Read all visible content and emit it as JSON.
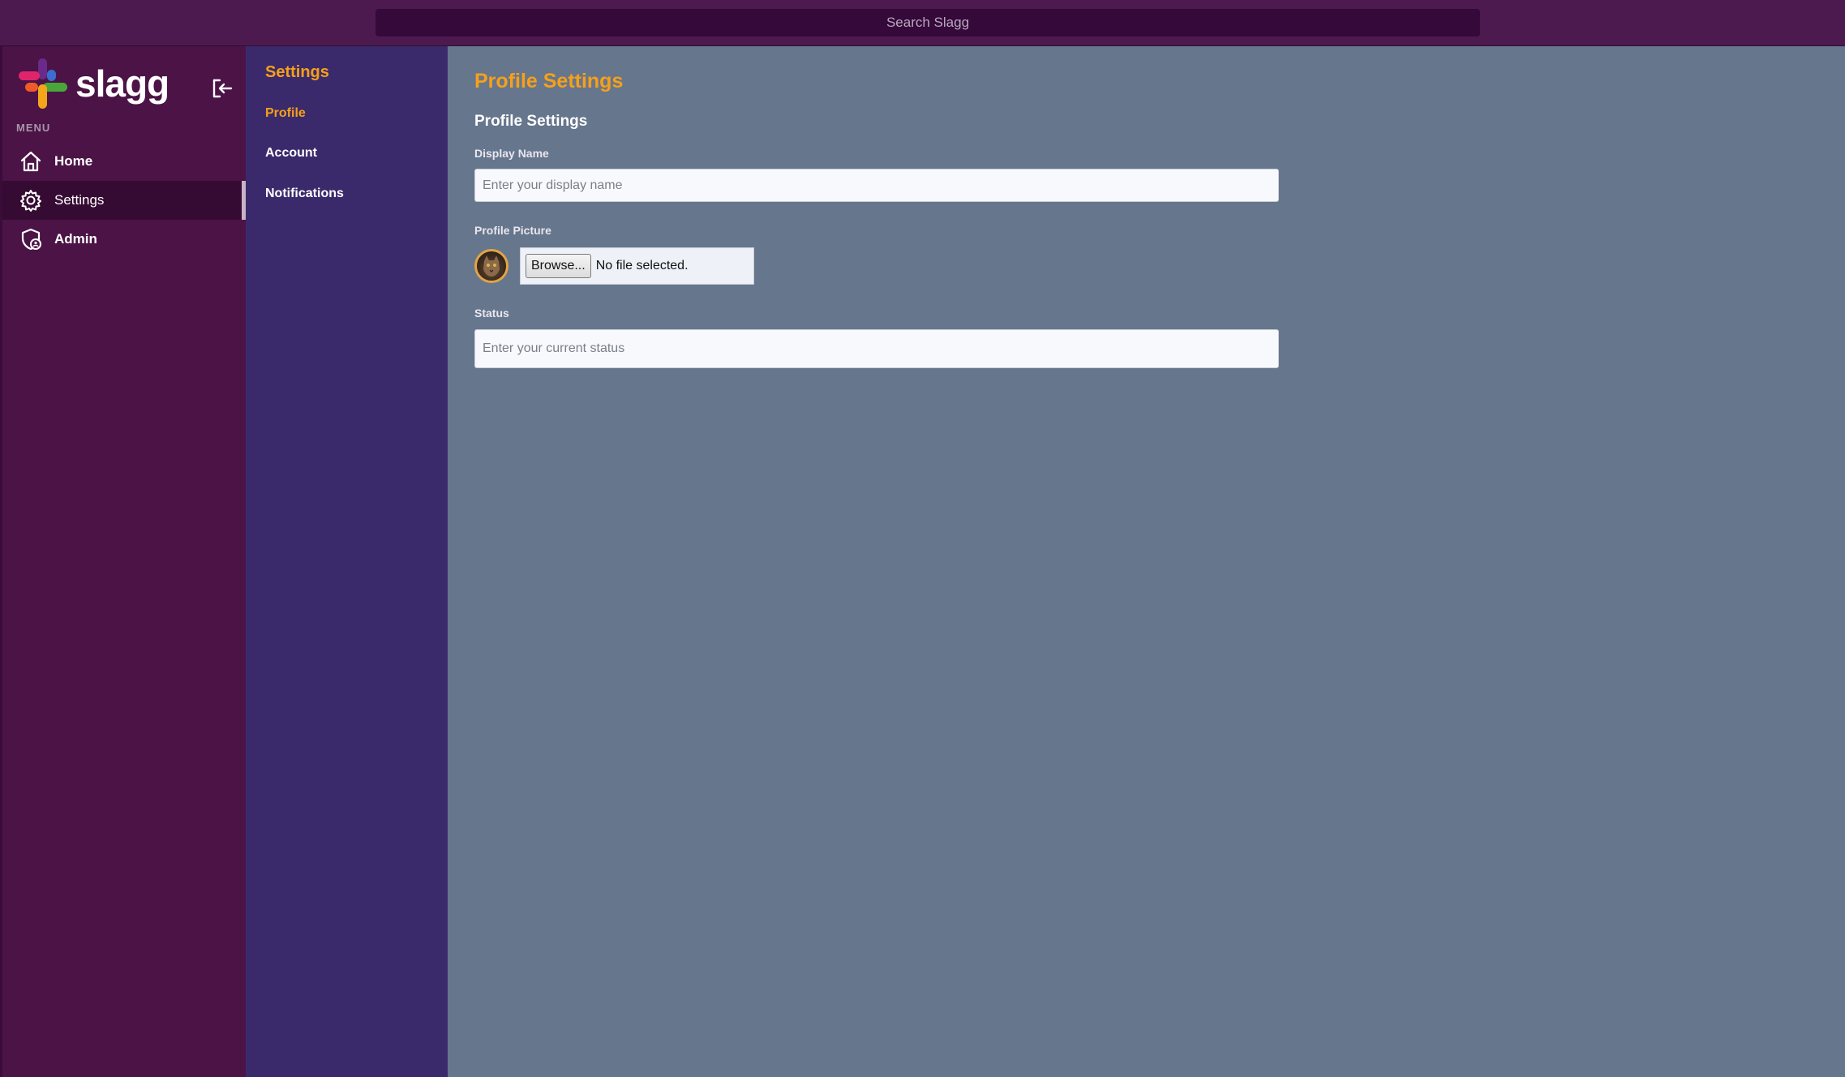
{
  "search": {
    "placeholder": "Search Slagg"
  },
  "brand": {
    "name": "slagg"
  },
  "sidebar": {
    "menu_label": "MENU",
    "items": [
      {
        "label": "Home",
        "icon": "home-icon"
      },
      {
        "label": "Settings",
        "icon": "gear-icon",
        "active": true
      },
      {
        "label": "Admin",
        "icon": "shield-user-icon"
      }
    ]
  },
  "subnav": {
    "title": "Settings",
    "items": [
      {
        "label": "Profile",
        "active": true
      },
      {
        "label": "Account"
      },
      {
        "label": "Notifications"
      }
    ]
  },
  "main": {
    "page_title": "Profile Settings",
    "section_title": "Profile Settings",
    "display_name": {
      "label": "Display Name",
      "value": "",
      "placeholder": "Enter your display name"
    },
    "profile_picture": {
      "label": "Profile Picture",
      "browse_label": "Browse...",
      "file_status": "No file selected."
    },
    "status": {
      "label": "Status",
      "value": "",
      "placeholder": "Enter your current status"
    }
  },
  "colors": {
    "accent": "#f6a01a",
    "sidebar_bg": "#4b1346",
    "subnav_bg": "#3b2a6b",
    "main_bg": "#66768d",
    "topbar_bg": "#4d1a4f"
  }
}
